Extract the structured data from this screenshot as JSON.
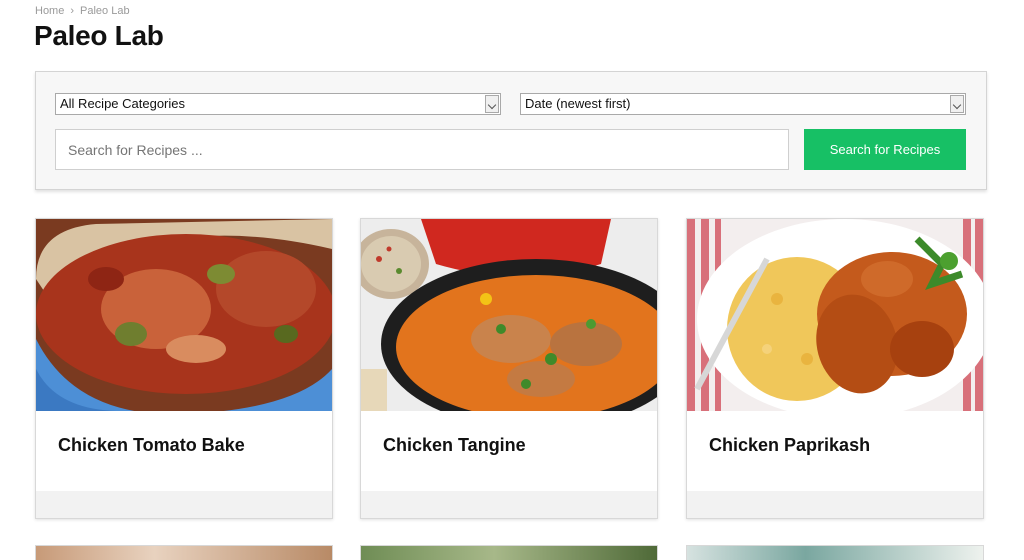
{
  "breadcrumb": {
    "home": "Home",
    "separator": "›",
    "current": "Paleo Lab"
  },
  "page": {
    "title": "Paleo Lab"
  },
  "filters": {
    "category_selected": "All Recipe Categories",
    "sort_selected": "Date (newest first)",
    "search_placeholder": "Search for Recipes ...",
    "search_button": "Search for Recipes"
  },
  "colors": {
    "accent": "#17c065",
    "panel_bg": "#f7f7f7",
    "card_footer": "#f2f2f2"
  },
  "recipes": [
    {
      "title": "Chicken Tomato Bake",
      "image": "chicken-tomato-bake-photo"
    },
    {
      "title": "Chicken Tangine",
      "image": "chicken-tagine-photo"
    },
    {
      "title": "Chicken Paprikash",
      "image": "chicken-paprikash-photo"
    }
  ],
  "more_recipes_row": [
    "recipe-card-4",
    "recipe-card-5",
    "recipe-card-6"
  ]
}
